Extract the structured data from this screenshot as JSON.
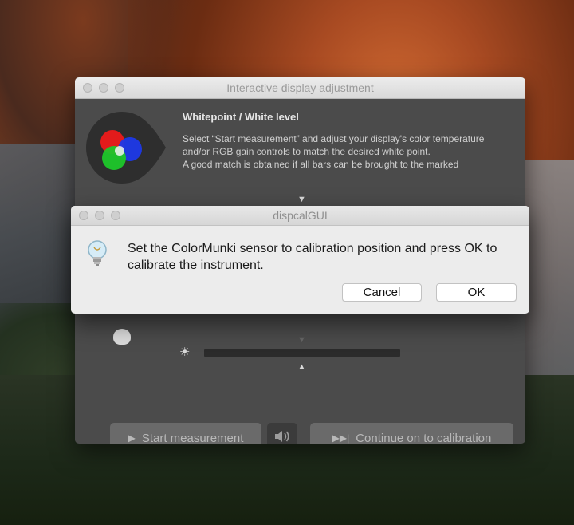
{
  "main_window": {
    "title": "Interactive display adjustment",
    "heading": "Whitepoint / White level",
    "description_line1": "Select “Start measurement” and adjust your display's color temperature and/or RGB gain controls to match the desired white point.",
    "description_line2": "A good match is obtained if all bars can be brought to the marked",
    "start_button_label": "Start measurement",
    "continue_button_label": "Continue on to calibration",
    "icons": {
      "rgb": "rgb-circles-icon",
      "sun": "brightness-icon",
      "speaker": "speaker-icon",
      "play": "play-icon",
      "skip": "skip-forward-icon"
    }
  },
  "dialog": {
    "title": "dispcalGUI",
    "message": "Set the ColorMunki sensor to calibration position and press OK to calibrate the instrument.",
    "cancel_label": "Cancel",
    "ok_label": "OK",
    "icon": "lightbulb-icon"
  },
  "glyphs": {
    "arrow_down": "▼",
    "arrow_up": "▲",
    "sun": "☀",
    "play": "▶",
    "skip": "▶▶|",
    "speaker": "🔊"
  }
}
